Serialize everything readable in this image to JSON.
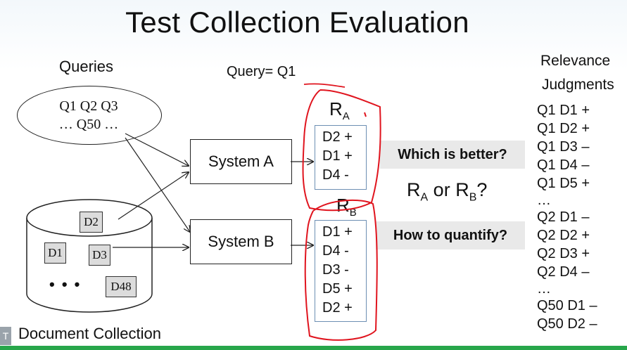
{
  "title": "Test Collection Evaluation",
  "queries": {
    "label": "Queries",
    "line1": "Q1  Q2 Q3",
    "line2": "… Q50 …"
  },
  "query_indicator": "Query= Q1",
  "systems": {
    "a": "System A",
    "b": "System B"
  },
  "results": {
    "a": {
      "label_main": "R",
      "label_sub": "A",
      "rows": [
        "D2 +",
        "D1 +",
        "D4  -"
      ]
    },
    "b": {
      "label_main": "R",
      "label_sub": "B",
      "rows": [
        "D1 +",
        "D4  -",
        "D3  -",
        "D5 +",
        "D2 +"
      ]
    }
  },
  "callouts": {
    "which_better": "Which  is better?",
    "how_quantify": "How to quantify?"
  },
  "comparison": {
    "r1": "R",
    "s1": "A",
    "or": " or ",
    "r2": "R",
    "s2": "B",
    "q": "?"
  },
  "documents": {
    "collection_label": "Document Collection",
    "items": [
      "D2",
      "D1",
      "D3",
      "D48"
    ],
    "ellipsis": "• • •"
  },
  "relevance": {
    "header_line1": "Relevance",
    "header_line2": "Judgments",
    "items": [
      "Q1  D1  +",
      "Q1  D2  +",
      "Q1  D3 –",
      "Q1  D4 –",
      "Q1  D5 +",
      "…",
      "Q2  D1 –",
      "Q2  D2 +",
      "Q2  D3 +",
      "Q2  D4 –",
      "…",
      "Q50 D1 –",
      "Q50 D2 –"
    ]
  },
  "colors": {
    "annotation_red": "#e0141e",
    "result_border": "#6d8fb3",
    "callout_bg": "#e9e9e9",
    "bottom_bar": "#27a64a"
  }
}
